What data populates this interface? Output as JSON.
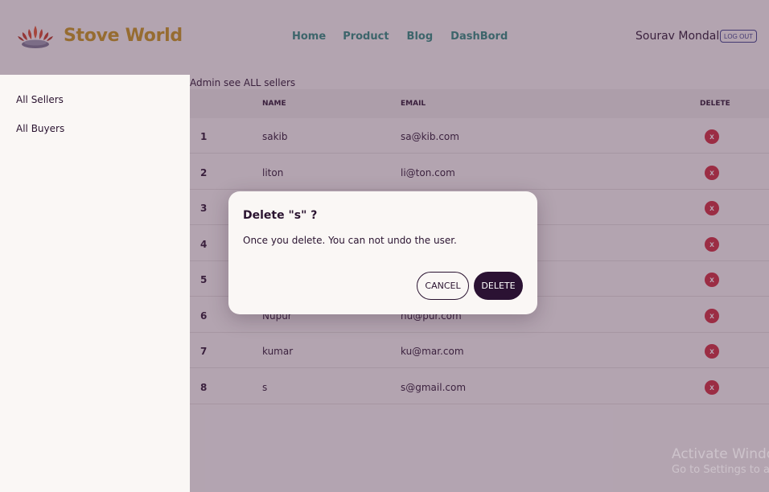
{
  "navbar": {
    "brand_name": "Stove World",
    "links": [
      "Home",
      "Product",
      "Blog",
      "DashBord"
    ],
    "user_name": "Sourav Mondal",
    "logout_label": "LOG OUT"
  },
  "sidebar": {
    "items": [
      {
        "label": "All Sellers"
      },
      {
        "label": "All Buyers"
      }
    ]
  },
  "main": {
    "title": "Admin see ALL sellers",
    "columns": [
      "",
      "NAME",
      "EMAIL",
      "DELETE"
    ],
    "rows": [
      {
        "num": "1",
        "name": "sakib",
        "email": "sa@kib.com"
      },
      {
        "num": "2",
        "name": "liton",
        "email": "li@ton.com"
      },
      {
        "num": "3",
        "name": "",
        "email": ""
      },
      {
        "num": "4",
        "name": "",
        "email": ""
      },
      {
        "num": "5",
        "name": "",
        "email": ""
      },
      {
        "num": "6",
        "name": "Nupur",
        "email": "nu@pur.com"
      },
      {
        "num": "7",
        "name": "kumar",
        "email": "ku@mar.com"
      },
      {
        "num": "8",
        "name": "s",
        "email": "s@gmail.com"
      }
    ],
    "delete_symbol": "x"
  },
  "modal": {
    "title": "Delete \"s\" ?",
    "text": "Once you delete. You can not undo the user.",
    "cancel_label": "CANCEL",
    "delete_label": "DELETE"
  },
  "watermark": {
    "line1": "Activate Windows",
    "line2": "Go to Settings to activate Windows."
  },
  "colors": {
    "brand": "#c8961a",
    "nav_link": "#2f8a7e",
    "primary_dark": "#2b1233",
    "danger": "#d12a3c",
    "overlay": "#503252"
  },
  "icons": {
    "logo": "stove-burner-logo",
    "delete": "close-x-icon"
  }
}
